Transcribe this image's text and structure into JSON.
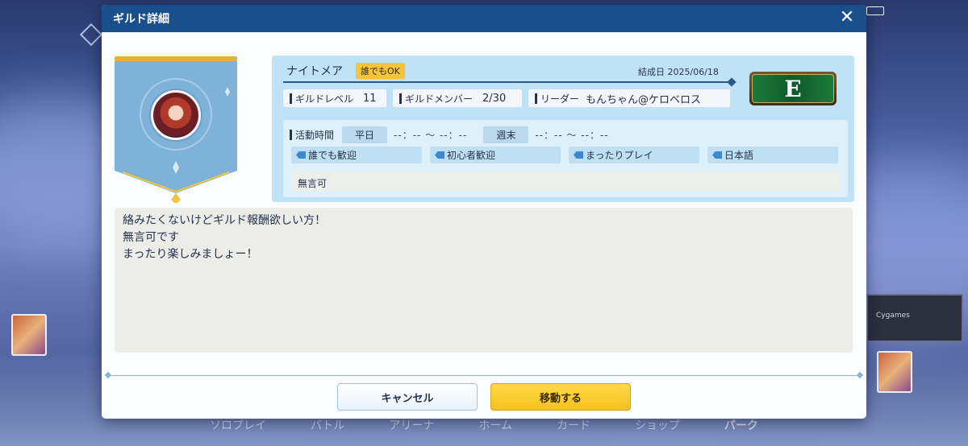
{
  "background": {
    "bottom_nav": [
      "ソロプレイ",
      "バトル",
      "アリーナ",
      "ホーム",
      "カード",
      "ショップ",
      "パーク"
    ],
    "board_text": "Cygames"
  },
  "modal": {
    "title": "ギルド詳細",
    "close_icon": "close-icon"
  },
  "guild": {
    "name": "ナイトメア",
    "join_tag": "誰でもOK",
    "founded": "結成日 2025/06/18",
    "rank": "E",
    "level_label": "ギルドレベル",
    "level_value": "11",
    "members_label": "ギルドメンバー",
    "members_value": "2/30",
    "leader_label": "リーダー",
    "leader_value": "もんちゃん@ケロベロス",
    "activity_label": "活動時間",
    "weekday_label": "平日",
    "weekday_time": "--：-- 〜 --：--",
    "weekend_label": "週末",
    "weekend_time": "--：-- 〜 --：--",
    "tags": [
      "誰でも歓迎",
      "初心者歓迎",
      "まったりプレイ",
      "日本語"
    ],
    "note": "無言可",
    "description": [
      "絡みたくないけどギルド報酬欲しい方！",
      "無言可です",
      "まったり楽しみましょー！"
    ]
  },
  "buttons": {
    "cancel": "キャンセル",
    "move": "移動する"
  },
  "colors": {
    "header": "#1a4f8b",
    "panel": "#bfe2f6",
    "accent_yellow": "#f5c21c",
    "rank_green": "#1d7a3a"
  }
}
